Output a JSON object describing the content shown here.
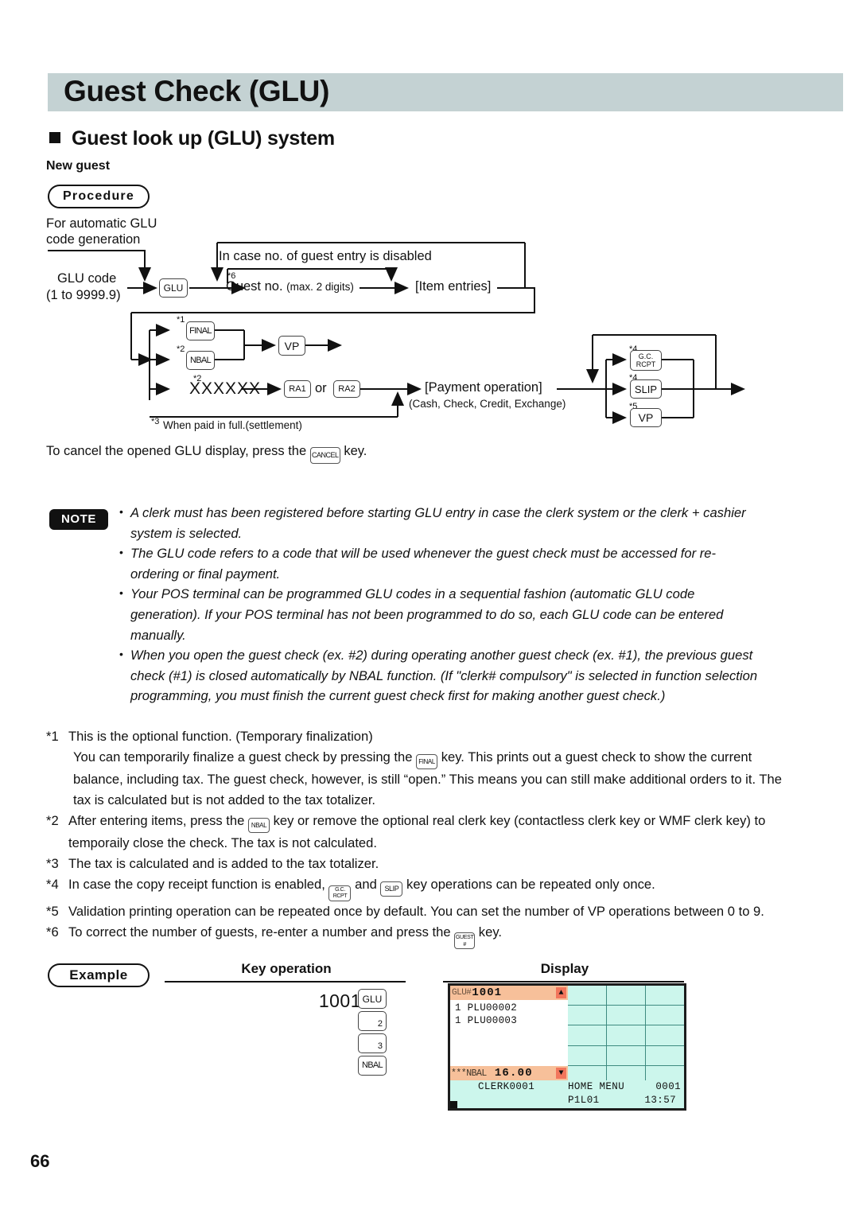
{
  "page": {
    "number": "66"
  },
  "header": {
    "title": "Guest Check (GLU)"
  },
  "section": {
    "heading": "Guest look up (GLU) system",
    "subheading": "New guest",
    "procedure_badge": "Procedure",
    "example_badge": "Example",
    "note_badge": "NOTE"
  },
  "flow": {
    "auto_label_line1": "For automatic GLU",
    "auto_label_line2": "code generation",
    "glu_code_line1": "GLU code",
    "glu_code_line2": "(1 to 9999.9)",
    "key_glu": "GLU",
    "disabled_label": "In case no. of guest entry is disabled",
    "guest_no": "Guest no.",
    "guest_no_suffix": "(max. 2 digits)",
    "guest_no_sup": "*6",
    "item_entries": "[Item entries]",
    "key_final": "FINAL",
    "key_final_sup": "*1",
    "key_nbal": "NBAL",
    "key_nbal_sup": "*2",
    "key_vp_left": "VP",
    "xxxxxx": "XXXXXX",
    "xxxxxx_sup": "*2",
    "key_ra1": "RA1",
    "or_label": "or",
    "key_ra2": "RA2",
    "payment_line1": "[Payment operation]",
    "payment_line2": "(Cash, Check, Credit, Exchange)",
    "paid_full_sup": "*3",
    "paid_full": "When paid in full.(settlement)",
    "key_gc_rcpt_l1": "G.C.",
    "key_gc_rcpt_l2": "RCPT",
    "key_gc_rcpt_sup": "*4",
    "key_slip": "SLIP",
    "key_slip_sup": "*4",
    "key_vp_right": "VP",
    "key_vp_right_sup": "*5"
  },
  "cancel": {
    "before": "To cancel the opened GLU display, press the",
    "key": "CANCEL",
    "after": "key."
  },
  "notes": [
    "A clerk must has been registered before starting GLU entry in case the clerk system or the clerk + cashier system is selected.",
    "The GLU code refers to a code that will be used whenever the guest check must be accessed for re-ordering or final payment.",
    "Your POS terminal can be programmed GLU codes in a sequential fashion (automatic GLU code generation).  If your POS terminal has not been programmed to do so, each GLU code can be entered manually.",
    "When you open the guest check (ex. #2) during operating another guest check (ex. #1), the previous guest check (#1) is closed automatically by NBAL function. (If \"clerk# compulsory\" is selected in function selection programming, you must finish the current guest check first for making another guest check.)"
  ],
  "footnotes": {
    "f1": {
      "marker": "*1",
      "part_a": "This is the optional function. (Temporary finalization)",
      "part_b1": "You can temporarily finalize a guest check by pressing the",
      "key": "FINAL",
      "part_b2": "key.  This prints out a guest check to show the current balance, including tax.  The guest check,  however, is still “open.”  This means you can still make additional orders to it.  The tax is calculated but is not added to the tax totalizer."
    },
    "f2": {
      "marker": "*2",
      "part_a": "After entering items, press the",
      "key": "NBAL",
      "part_b": "key or remove the optional real clerk key (contactless clerk key or WMF clerk key) to temporaily close the check. The tax is not calculated."
    },
    "f3": {
      "marker": "*3",
      "text": "The tax is calculated and is added to the tax totalizer."
    },
    "f4": {
      "marker": "*4",
      "part_a": "In case the copy receipt function is enabled,",
      "key1_l1": "G.C.",
      "key1_l2": "RCPT",
      "part_b": "and",
      "key2": "SLIP",
      "part_c": "key operations can be repeated only once."
    },
    "f5": {
      "marker": "*5",
      "text": "Validation printing operation can be repeated once by default. You can set the number of VP operations between 0 to 9."
    },
    "f6": {
      "marker": "*6",
      "part_a": "To correct the number of guests, re-enter a number and press the",
      "key_l1": "GUEST",
      "key_l2": "#",
      "part_b": "key."
    }
  },
  "example": {
    "key_operation_header": "Key operation",
    "display_header": "Display",
    "entry_number": "1001",
    "keys": [
      "GLU",
      "2",
      "3",
      "NBAL"
    ]
  },
  "lcd": {
    "glu_label": "GLU#",
    "glu_value": "1001",
    "scroll_up": "▲",
    "scroll_down": "▼",
    "items": [
      "1 PLU00002",
      "1 PLU00003"
    ],
    "nbal_label": "***NBAL",
    "nbal_amount": "16.00",
    "clerk": "CLERK0001",
    "menu": "HOME MENU",
    "register": "0001",
    "page_key": "P1L01",
    "time": "13:57"
  },
  "colors": {
    "title_bar": "#c4d2d3",
    "lcd_orange": "#f7c09a",
    "lcd_arrow": "#f2765c",
    "lcd_cyan": "#ccf6ec",
    "lcd_grid_line": "#3e8b80"
  }
}
